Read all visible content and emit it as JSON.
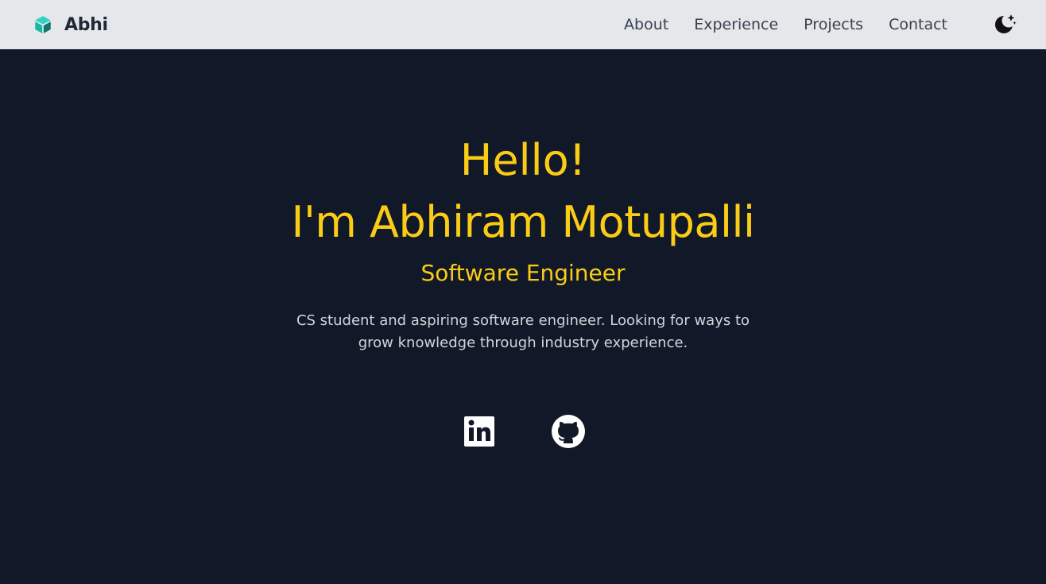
{
  "header": {
    "brand": "Abhi",
    "brand_icon": "cube-icon",
    "nav": [
      {
        "label": "About"
      },
      {
        "label": "Experience"
      },
      {
        "label": "Projects"
      },
      {
        "label": "Contact"
      }
    ],
    "theme_toggle_icon": "moon-stars-icon"
  },
  "hero": {
    "greeting": "Hello!",
    "name": "I'm Abhiram Motupalli",
    "role": "Software Engineer",
    "bio": "CS student and aspiring software engineer. Looking for ways to grow knowledge through industry experience.",
    "social": [
      {
        "icon": "linkedin-icon"
      },
      {
        "icon": "github-icon"
      }
    ]
  },
  "colors": {
    "header_bg": "#e5e7eb",
    "page_bg": "#111827",
    "accent": "#facc15",
    "brand_icon": "#14b8a6",
    "body_text": "#d1d5db"
  }
}
